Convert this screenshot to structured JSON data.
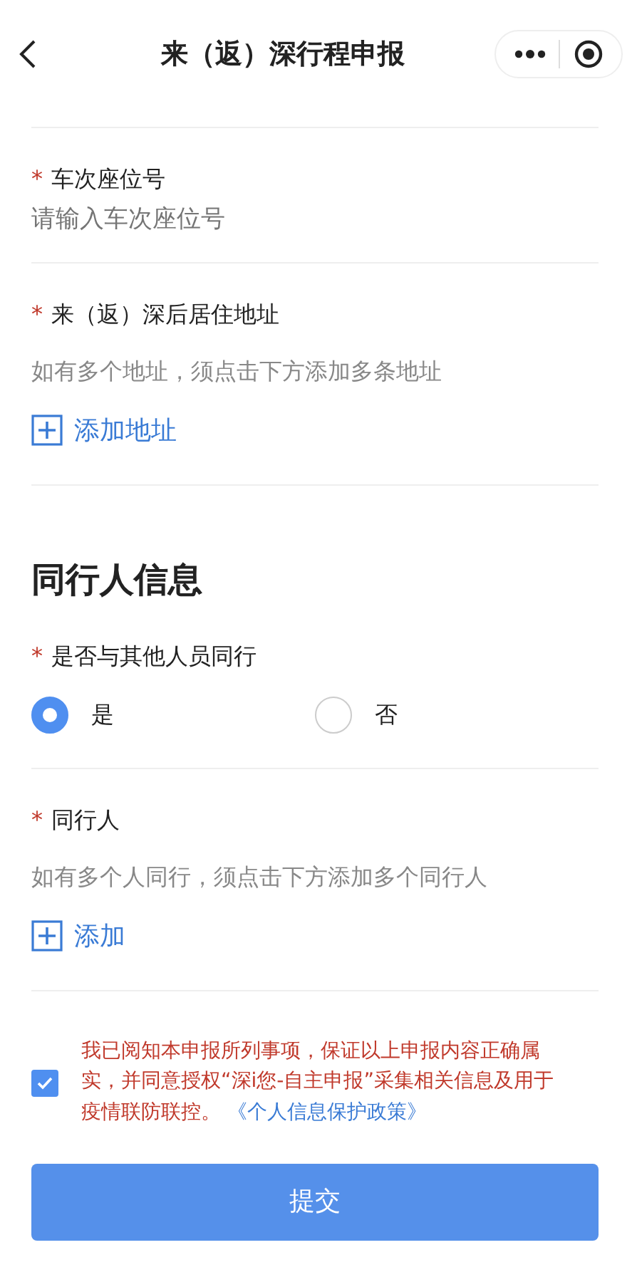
{
  "header": {
    "title": "来（返）深行程申报"
  },
  "fields": [
    {
      "kind": "input",
      "required_mark": "*",
      "label": "车次座位号",
      "placeholder": "请输入车次座位号"
    },
    {
      "kind": "address",
      "required_mark": "*",
      "label": "来（返）深后居住地址",
      "hint": "如有多个地址，须点击下方添加多条地址",
      "add_label": "添加地址"
    }
  ],
  "section": {
    "title": "同行人信息",
    "fields": [
      {
        "kind": "radio",
        "required_mark": "*",
        "label": "是否与其他人员同行",
        "options": [
          {
            "label": "是",
            "selected": true
          },
          {
            "label": "否",
            "selected": false
          }
        ]
      },
      {
        "kind": "address",
        "required_mark": "*",
        "label": "同行人",
        "hint": "如有多个人同行，须点击下方添加多个同行人",
        "add_label": "添加"
      }
    ]
  },
  "agreement": {
    "checked": true,
    "text": "我已阅知本申报所列事项，保证以上申报内容正确属实，并同意授权“深i您-自主申报”采集相关信息及用于疫情联防联控。",
    "link": "《个人信息保护政策》"
  },
  "submit": "提交"
}
